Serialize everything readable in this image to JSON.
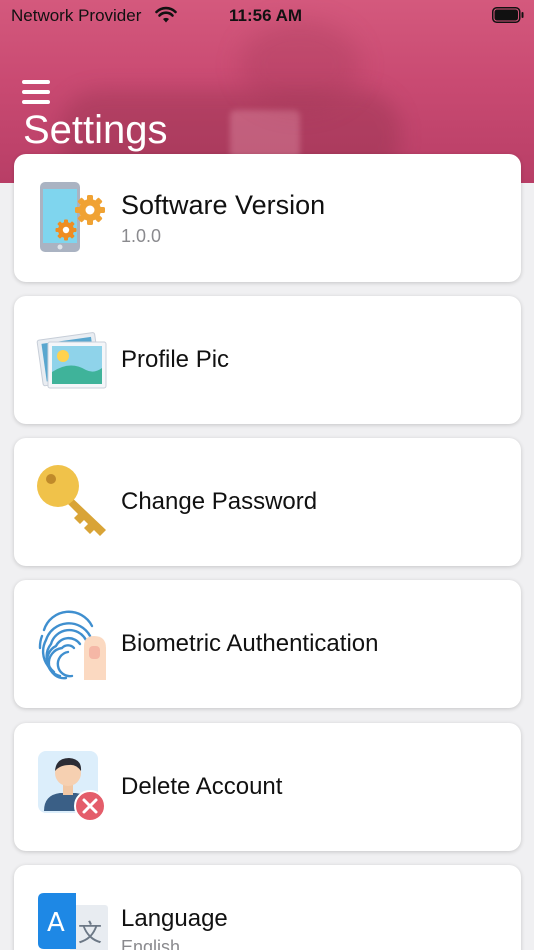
{
  "status_bar": {
    "carrier": "Network Provider",
    "time": "11:56 AM"
  },
  "header": {
    "title": "Settings",
    "menu_icon": "hamburger-menu-icon"
  },
  "settings": [
    {
      "label": "Software Version",
      "value": "1.0.0",
      "icon": "phone-gears-icon"
    },
    {
      "label": "Profile Pic",
      "icon": "photo-icon"
    },
    {
      "label": "Change Password",
      "icon": "key-icon"
    },
    {
      "label": "Biometric Authentication",
      "icon": "fingerprint-icon"
    },
    {
      "label": "Delete Account",
      "icon": "delete-user-icon"
    },
    {
      "label": "Language",
      "value": "English",
      "icon": "translate-icon"
    }
  ],
  "colors": {
    "header": "#c94a72",
    "background": "#f0f0f2",
    "card": "#ffffff",
    "subtext": "#8a8a8e"
  }
}
